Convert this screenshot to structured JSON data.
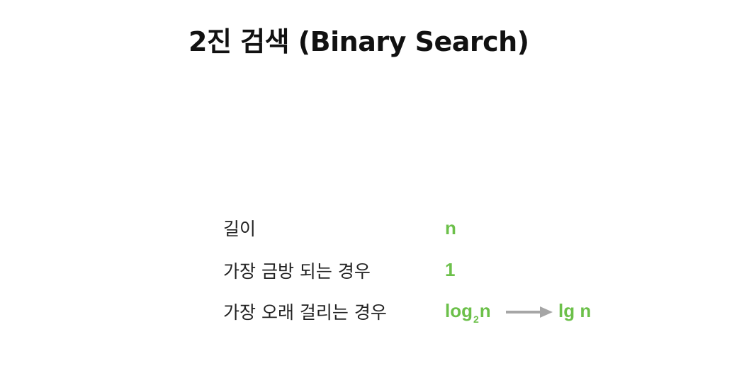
{
  "title": "2진 검색 (Binary Search)",
  "colors": {
    "value_green": "#6cc04a",
    "arrow_gray": "#a6a6a6",
    "text": "#222222"
  },
  "rows": [
    {
      "label": "길이",
      "value": "n"
    },
    {
      "label": "가장 금방 되는 경우",
      "value": "1"
    },
    {
      "label": "가장 오래 걸리는 경우",
      "value_base": "log",
      "value_sub": "2",
      "value_tail": "n"
    }
  ],
  "simplified": "lg n",
  "arrow_icon": "right-arrow-icon"
}
